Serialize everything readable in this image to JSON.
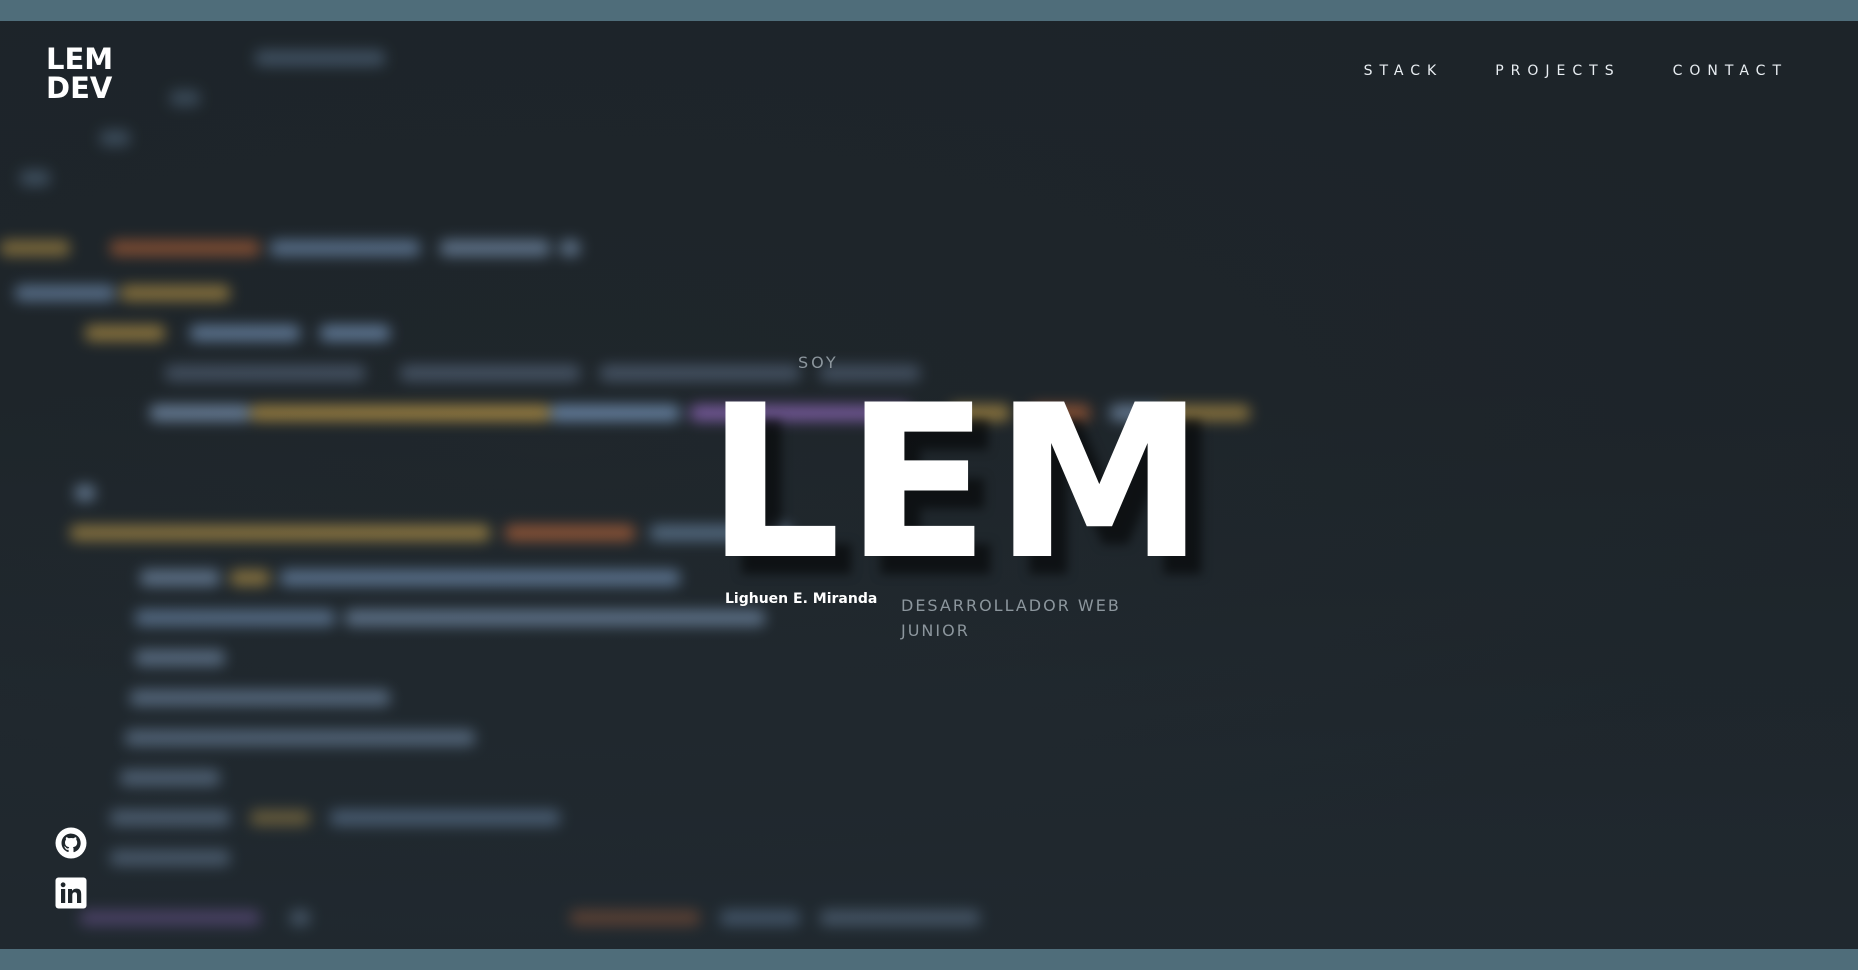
{
  "brand": {
    "line1": "LEM",
    "line2": "DEV"
  },
  "nav": {
    "items": [
      {
        "label": "STACK"
      },
      {
        "label": "PROJECTS"
      },
      {
        "label": "CONTACT"
      }
    ]
  },
  "hero": {
    "intro": "SOY",
    "title": "LEM",
    "name": "Lighuen E. Miranda",
    "role": "DESARROLLADOR WEB JUNIOR"
  },
  "social": {
    "items": [
      {
        "icon": "github-icon"
      },
      {
        "icon": "linkedin-icon"
      }
    ]
  },
  "colors": {
    "frame_border": "#4f6d7a",
    "background": "#1f262b",
    "text_primary": "#ffffff",
    "text_muted": "#8c969d"
  }
}
